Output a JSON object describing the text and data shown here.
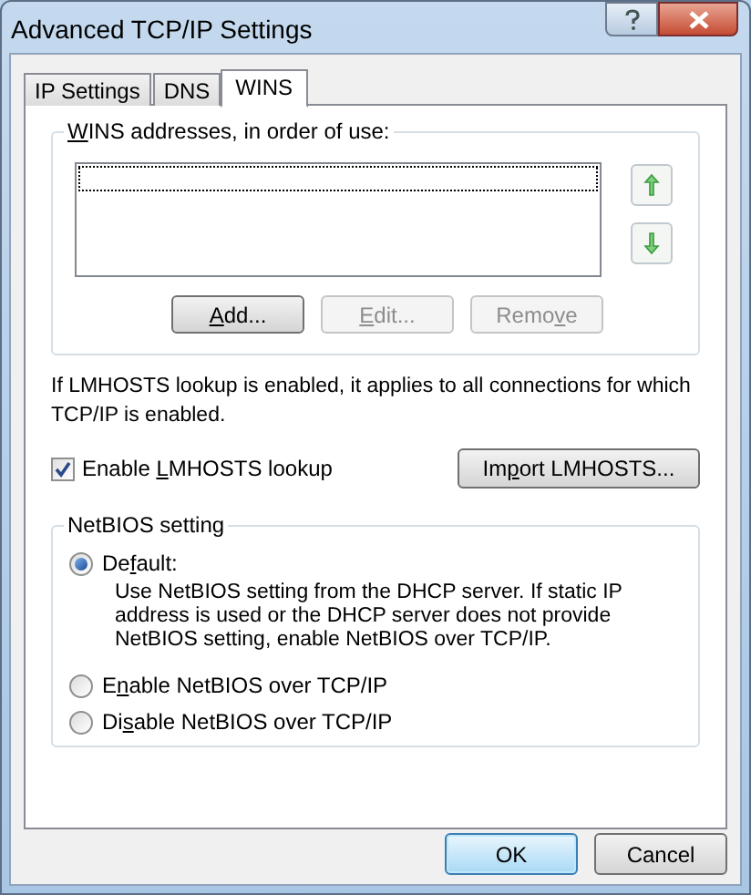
{
  "window": {
    "title": "Advanced TCP/IP Settings"
  },
  "tabs": [
    {
      "label": "IP Settings",
      "selected": false
    },
    {
      "label": "DNS",
      "selected": false
    },
    {
      "label": "WINS",
      "selected": true
    }
  ],
  "wins_group": {
    "label_parts": {
      "key": "W",
      "after": "INS addresses, in order of use:"
    },
    "buttons": [
      {
        "label_parts": {
          "key": "A",
          "after": "dd..."
        },
        "disabled": false
      },
      {
        "label_parts": {
          "key": "E",
          "after": "dit..."
        },
        "disabled": true
      },
      {
        "label_parts": {
          "before": "Remo",
          "key": "v",
          "after": "e"
        },
        "disabled": true
      }
    ]
  },
  "lmhosts_note": "If LMHOSTS lookup is enabled, it applies to all connections for which TCP/IP is enabled.",
  "lmhosts_checkbox": {
    "label_parts": {
      "before": "Enable ",
      "key": "L",
      "after": "MHOSTS lookup"
    },
    "checked": true
  },
  "import_button": {
    "label_parts": {
      "before": "Im",
      "key": "p",
      "after": "ort LMHOSTS..."
    }
  },
  "netbios_group": {
    "label": "NetBIOS setting",
    "options": [
      {
        "label_parts": {
          "before": "De",
          "key": "f",
          "after": "ault:"
        },
        "selected": true,
        "description": "Use NetBIOS setting from the DHCP server. If static IP address is used or the DHCP server does not provide NetBIOS setting, enable NetBIOS over TCP/IP."
      },
      {
        "label_parts": {
          "before": "E",
          "key": "n",
          "after": "able NetBIOS over TCP/IP"
        },
        "selected": false
      },
      {
        "label_parts": {
          "before": "Di",
          "key": "s",
          "after": "able NetBIOS over TCP/IP"
        },
        "selected": false
      }
    ]
  },
  "buttons": [
    {
      "label": "OK",
      "default": true
    },
    {
      "label": "Cancel",
      "default": false
    }
  ]
}
